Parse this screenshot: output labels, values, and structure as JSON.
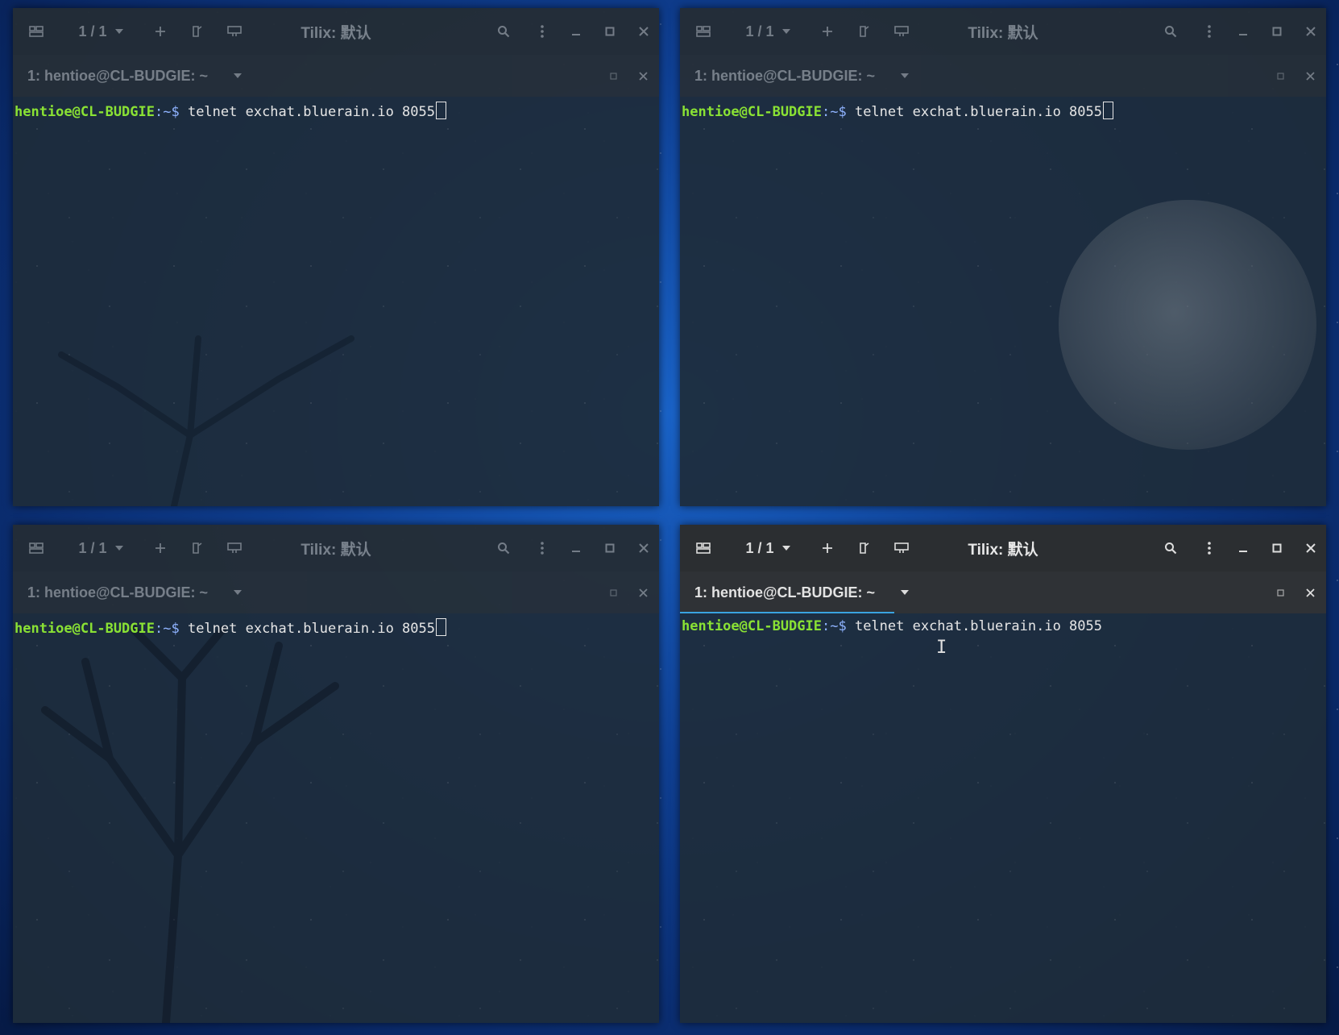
{
  "windows": [
    {
      "id": "tl",
      "session_counter": "1 / 1",
      "title": "Tilix: 默认",
      "tab_label": "1: hentioe@CL-BUDGIE: ~",
      "prompt_user": "hentioe@CL-BUDGIE",
      "prompt_path": ":~$",
      "command": " telnet exchat.bluerain.io 8055",
      "active": false
    },
    {
      "id": "tr",
      "session_counter": "1 / 1",
      "title": "Tilix: 默认",
      "tab_label": "1: hentioe@CL-BUDGIE: ~",
      "prompt_user": "hentioe@CL-BUDGIE",
      "prompt_path": ":~$",
      "command": " telnet exchat.bluerain.io 8055",
      "active": false
    },
    {
      "id": "bl",
      "session_counter": "1 / 1",
      "title": "Tilix: 默认",
      "tab_label": "1: hentioe@CL-BUDGIE: ~",
      "prompt_user": "hentioe@CL-BUDGIE",
      "prompt_path": ":~$",
      "command": " telnet exchat.bluerain.io 8055",
      "active": false
    },
    {
      "id": "br",
      "session_counter": "1 / 1",
      "title": "Tilix: 默认",
      "tab_label": "1: hentioe@CL-BUDGIE: ~",
      "prompt_user": "hentioe@CL-BUDGIE",
      "prompt_path": ":~$",
      "command": " telnet exchat.bluerain.io 8055",
      "active": true
    }
  ],
  "icons": {
    "session": "session-sidebar-icon",
    "add": "add-terminal-icon",
    "split_right": "split-right-icon",
    "split_down": "split-down-icon",
    "search": "search-icon",
    "menu": "kebab-menu-icon",
    "minimize": "minimize-icon",
    "maximize": "maximize-icon",
    "close": "close-icon"
  },
  "colors": {
    "prompt_user": "#8ae234",
    "tab_active_underline": "#3aa3e0",
    "titlebar_bg": "#2b2e31"
  }
}
